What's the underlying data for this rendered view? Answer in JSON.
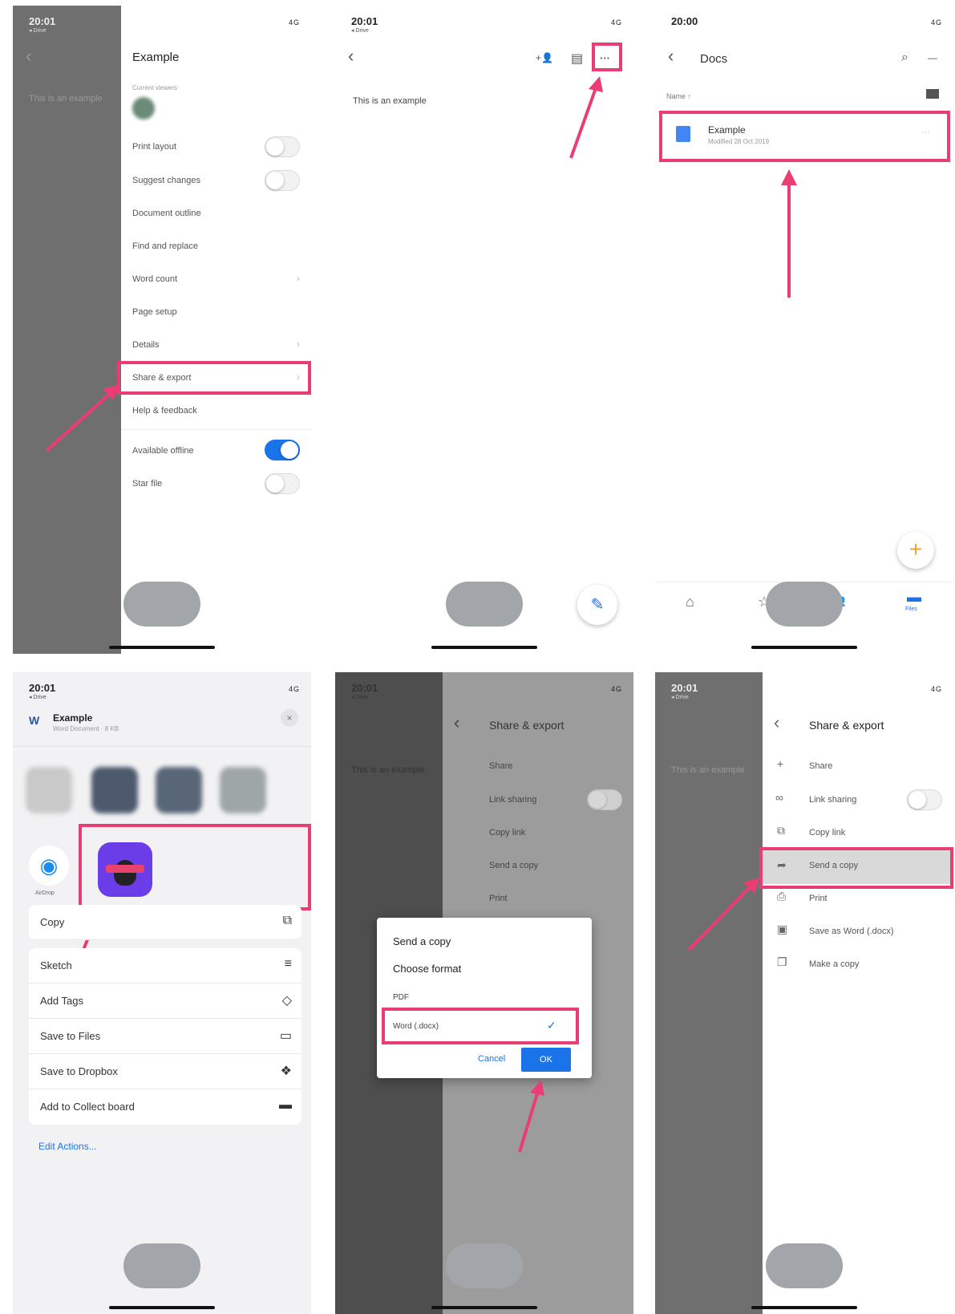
{
  "phone1": {
    "time": "20:01",
    "status_sub": "◂ Drive",
    "status_icons": "4G",
    "doc_text": "This is an example",
    "menu_title": "Example",
    "current_viewers_label": "Current viewers",
    "items": {
      "print_layout": "Print layout",
      "suggest_changes": "Suggest changes",
      "document_outline": "Document outline",
      "find_replace": "Find and replace",
      "word_count": "Word count",
      "page_setup": "Page setup",
      "details": "Details",
      "share_export": "Share & export",
      "help_feedback": "Help & feedback",
      "available_offline": "Available offline",
      "star_file": "Star file"
    },
    "chevron": "›"
  },
  "phone2": {
    "time": "20:01",
    "status_sub": "◂ Drive",
    "status_icons": "4G",
    "doc_text": "This is an example",
    "more_label": "···",
    "add_person_icon": "+👤",
    "comment_icon": "▤",
    "edit_icon": "✎"
  },
  "phone3": {
    "time": "20:00",
    "status_icons": "4G",
    "title": "Docs",
    "sort_label": "Name ↑",
    "file_name": "Example",
    "file_modified": "Modified 28 Oct 2019",
    "more_label": "···",
    "fab": "+",
    "nav": {
      "home": "⌂",
      "starred": "☆",
      "shared": "👥",
      "files": "▬",
      "files_label": "Files"
    }
  },
  "phone4": {
    "time": "20:01",
    "status_sub": "◂ Drive",
    "status_icons": "4G",
    "file_name": "Example",
    "file_sub": "Word Document · 8 KB",
    "close": "×",
    "airdrop_label": "AirDrop",
    "actions": {
      "copy": "Copy",
      "sketch": "Sketch",
      "add_tags": "Add Tags",
      "save_files": "Save to Files",
      "save_dropbox": "Save to Dropbox",
      "add_collect": "Add to Collect board"
    },
    "edit_actions": "Edit Actions..."
  },
  "phone5": {
    "time": "20:01",
    "status_sub": "◂ Drive",
    "status_icons": "4G",
    "doc_text": "This is an example",
    "title": "Share & export",
    "items": {
      "share": "Share",
      "link_sharing": "Link sharing",
      "copy_link": "Copy link",
      "send_copy": "Send a copy",
      "print": "Print"
    },
    "dialog": {
      "title": "Send a copy",
      "subtitle": "Choose format",
      "pdf": "PDF",
      "word": "Word (.docx)",
      "check": "✓",
      "cancel": "Cancel",
      "ok": "OK"
    }
  },
  "phone6": {
    "time": "20:01",
    "status_sub": "◂ Drive",
    "status_icons": "4G",
    "doc_text": "This is an example",
    "title": "Share & export",
    "items": {
      "share": "Share",
      "link_sharing": "Link sharing",
      "copy_link": "Copy link",
      "send_copy": "Send a copy",
      "print": "Print",
      "save_word": "Save as Word (.docx)",
      "make_copy": "Make a copy"
    }
  },
  "colors": {
    "highlight": "#ea3d74",
    "accent_blue": "#1a73e8",
    "overlay_gray": "#6f6f6f"
  }
}
